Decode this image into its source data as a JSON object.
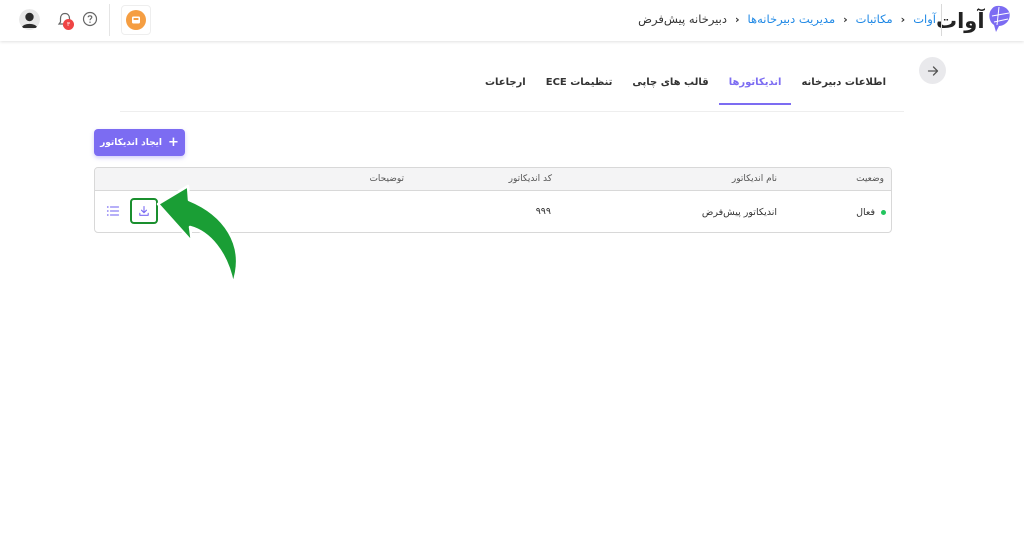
{
  "header": {
    "brand_name": "آوات",
    "breadcrumb": [
      {
        "label": "آوات",
        "link": true
      },
      {
        "label": "مکاتبات",
        "link": true
      },
      {
        "label": "مدیریت دبیرخانه‌ها",
        "link": true
      },
      {
        "label": "دبیرخانه پیش‌فرض",
        "link": false
      }
    ],
    "notification_count": "۳",
    "icons": [
      "user-avatar-icon",
      "bell-icon",
      "help-icon",
      "app-launcher-icon"
    ]
  },
  "tabs": [
    {
      "label": "اطلاعات دبیرخانه",
      "active": false
    },
    {
      "label": "اندیکاتورها",
      "active": true
    },
    {
      "label": "قالب های چاپی",
      "active": false
    },
    {
      "label": "تنظیمات ECE",
      "active": false
    },
    {
      "label": "ارجاعات",
      "active": false
    }
  ],
  "create_button": {
    "label": "ایجاد اندیکاتور",
    "icon": "plus-icon"
  },
  "table": {
    "columns": {
      "status": "وضعیت",
      "name": "نام اندیکاتور",
      "code": "کد اندیکاتور",
      "description": "توضیحات"
    },
    "rows": [
      {
        "status": "فعال",
        "name": "اندیکاتور پیش‌فرض",
        "code": "۹۹۹",
        "description": ""
      }
    ]
  },
  "colors": {
    "accent": "#7c6cf2",
    "link": "#1e88e5",
    "status_active": "#22c55e",
    "highlight": "#1a8f2e"
  }
}
